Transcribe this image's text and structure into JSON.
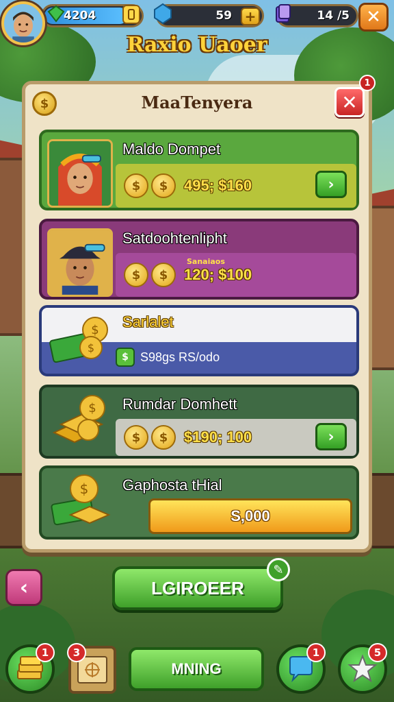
{
  "hud": {
    "gems_value": "4204",
    "energy_value": "59",
    "energy_plus": "+",
    "cards_value": "14 /5",
    "close_label": "✕",
    "level_fill": 0.85
  },
  "game_title": "Raxio Uaoer",
  "panel": {
    "title": "MaaTenyera",
    "coin_symbol": "$",
    "close_label": "✕",
    "corner_badge": "1"
  },
  "offers": [
    {
      "name": "Maldo Dompet",
      "coin_count": 2,
      "price": "495; $160",
      "button": "›",
      "theme": "green"
    },
    {
      "name": "Satdoohtenlipht",
      "sub_label": "Sanaiaos",
      "coin_count": 2,
      "price": "120; $100",
      "theme": "purple"
    },
    {
      "name": "Sarlalet",
      "price": "S98gs RS/odo",
      "theme": "selected"
    },
    {
      "name": "Rumdar Domhett",
      "coin_count": 2,
      "price": "$190; 100",
      "button": "›",
      "theme": "dark"
    },
    {
      "name": "Gaphosta tHial",
      "price": "S,000",
      "theme": "green-dark"
    }
  ],
  "bottom": {
    "back_label": "‹",
    "main_button": "LGIROEER",
    "pencil_icon": "✎",
    "mining_button": "MNING",
    "badge_left": "1",
    "badge_map": "3",
    "badge_chat": "1",
    "badge_star": "5"
  },
  "colors": {
    "accent_gold": "#ffd33a",
    "green_button": "#3fa02a",
    "red_close": "#c82424",
    "panel_bg": "#efe3c7"
  }
}
